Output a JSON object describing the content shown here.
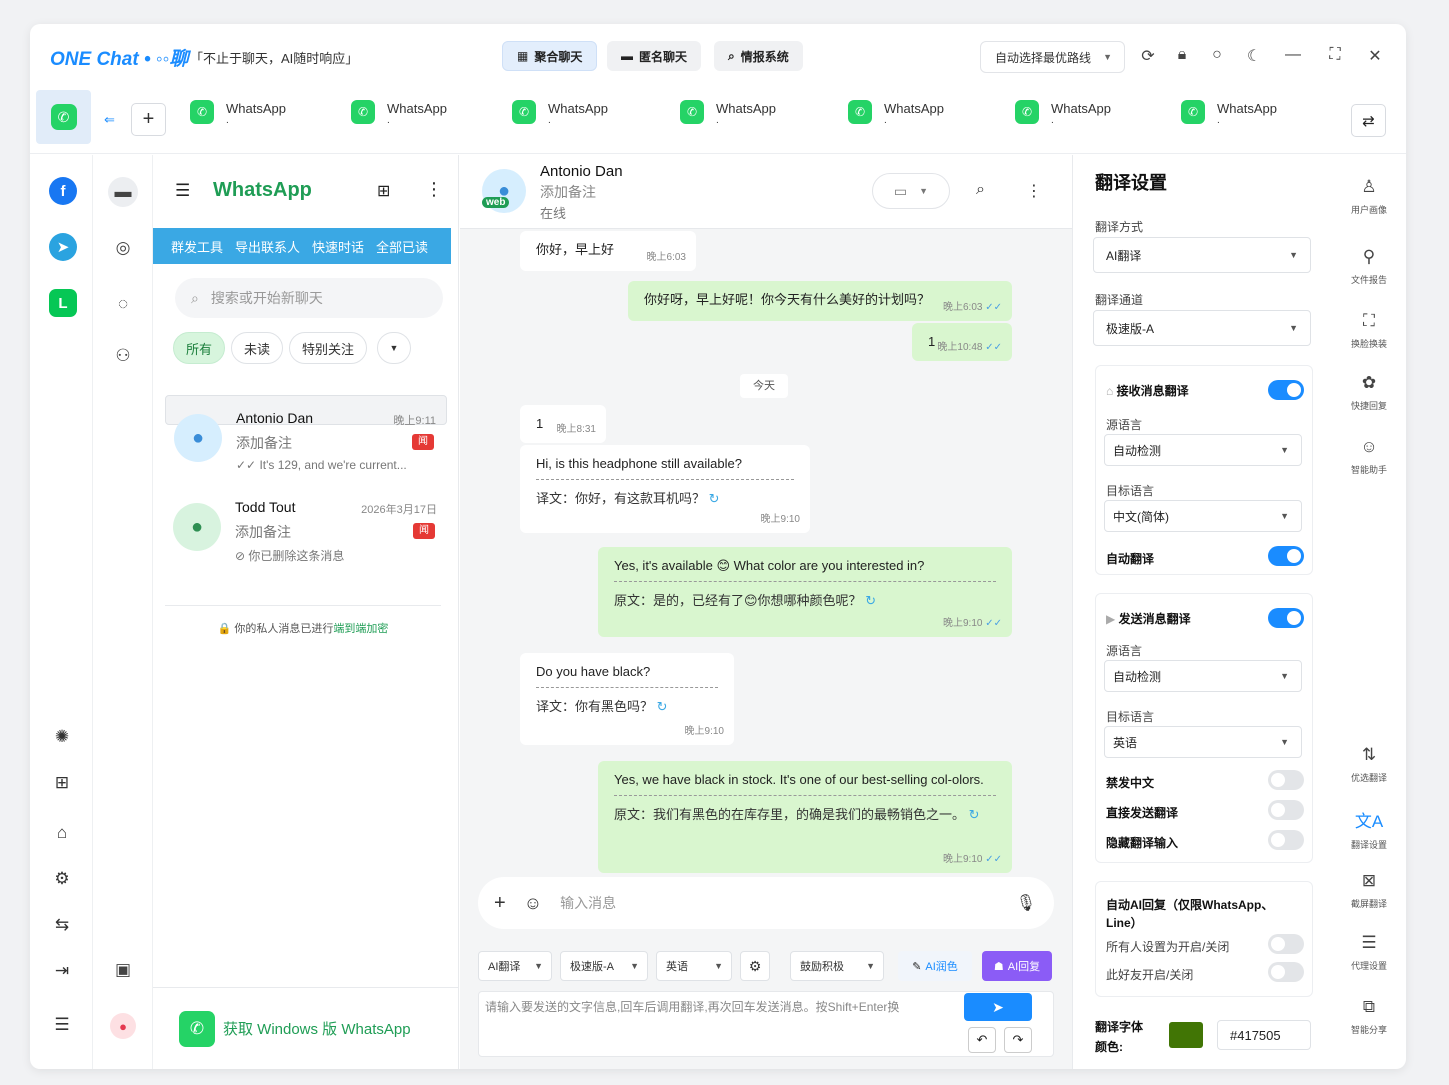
{
  "app": {
    "logo_text": "ONE Chat • ◦◦聊",
    "slogan": "「不止于聊天，AI随时响应」"
  },
  "modes": [
    {
      "label": "聚合聊天",
      "icon": "grid-icon"
    },
    {
      "label": "匿名聊天",
      "icon": "incognito-icon"
    },
    {
      "label": "情报系统",
      "icon": "search-icon"
    }
  ],
  "route": {
    "label": "自动选择最优路线"
  },
  "tabs": [
    {
      "name": "WhatsApp",
      "sub": "."
    },
    {
      "name": "WhatsApp",
      "sub": "."
    },
    {
      "name": "WhatsApp",
      "sub": "."
    },
    {
      "name": "WhatsApp",
      "sub": "."
    },
    {
      "name": "WhatsApp",
      "sub": "."
    },
    {
      "name": "WhatsApp",
      "sub": "."
    },
    {
      "name": "WhatsApp",
      "sub": "."
    }
  ],
  "chatlist": {
    "title": "WhatsApp",
    "tools": [
      "群发工具",
      "导出联系人",
      "快速时话",
      "全部已读"
    ],
    "search_placeholder": "搜索或开始新聊天",
    "filters": [
      "所有",
      "未读",
      "特别关注"
    ],
    "items": [
      {
        "name": "Antonio Dan",
        "time": "晚上9:11",
        "note": "添加备注",
        "badge": "闻",
        "last": "✓✓ It's 129, and we're current..."
      },
      {
        "name": "Todd Tout",
        "time": "2026年3月17日",
        "note": "添加备注",
        "badge": "闻",
        "last": "⊘ 你已删除这条消息"
      }
    ],
    "e2e_prefix": "🔒 你的私人消息已进行",
    "e2e_link": "端到端加密",
    "get_windows": "获取 Windows 版 WhatsApp"
  },
  "conversation": {
    "name": "Antonio Dan",
    "note": "添加备注",
    "status": "在线",
    "web_badge": "web",
    "day_pill": "今天",
    "messages": [
      {
        "text": "你好，早上好",
        "time": "晚上6:03"
      },
      {
        "text": "你好呀，早上好呢！你今天有什么美好的计划吗？",
        "time": "晚上6:03"
      },
      {
        "text": "1",
        "time": "晚上10:48"
      },
      {
        "text": "1",
        "time": "晚上8:31"
      },
      {
        "text": "Hi, is this headphone still available?",
        "trans": "译文：你好，有这款耳机吗？",
        "time": "晚上9:10"
      },
      {
        "text": "Yes, it's available 😊 What color are you interested in?",
        "trans": "原文：是的，已经有了😊你想哪种颜色呢？",
        "time": "晚上9:10"
      },
      {
        "text": "Do you have black?",
        "trans": "译文：你有黑色吗？",
        "time": "晚上9:10"
      },
      {
        "text": "Yes, we have black in stock. It's one of our best-selling col-olors.",
        "trans": "原文：我们有黑色的在库存里，的确是我们的最畅销色之一。",
        "time": "晚上9:10"
      }
    ],
    "input_placeholder": "输入消息",
    "controls": {
      "engine": "AI翻译",
      "channel": "极速版-A",
      "lang": "英语",
      "tone": "鼓励积极",
      "ai_polish": "AI润色",
      "ai_reply": "AI回复"
    },
    "compose_placeholder": "请输入要发送的文字信息,回车后调用翻译,再次回车发送消息。按Shift+Enter换"
  },
  "translate": {
    "title": "翻译设置",
    "method_label": "翻译方式",
    "method": "AI翻译",
    "channel_label": "翻译通道",
    "channel": "极速版-A",
    "recv": {
      "title": "接收消息翻译",
      "src_label": "源语言",
      "src": "自动检测",
      "tgt_label": "目标语言",
      "tgt": "中文(简体)",
      "auto_label": "自动翻译"
    },
    "send": {
      "title": "发送消息翻译",
      "src_label": "源语言",
      "src": "自动检测",
      "tgt_label": "目标语言",
      "tgt": "英语",
      "ban_cn": "禁发中文",
      "direct": "直接发送翻译",
      "hide": "隐藏翻译输入"
    },
    "ai": {
      "title": "自动AI回复（仅限WhatsApp、Line）",
      "all": "所有人设置为开启/关闭",
      "this": "此好友开启/关闭"
    },
    "font_label": "翻译字体",
    "color_label": "颜色:",
    "color_hex": "#417505",
    "color": "#417505"
  },
  "rightrail": [
    "用户画像",
    "文件报告",
    "换脸换装",
    "快捷回复",
    "智能助手",
    "优选翻译",
    "翻译设置",
    "截屏翻译",
    "代理设置",
    "智能分享"
  ]
}
